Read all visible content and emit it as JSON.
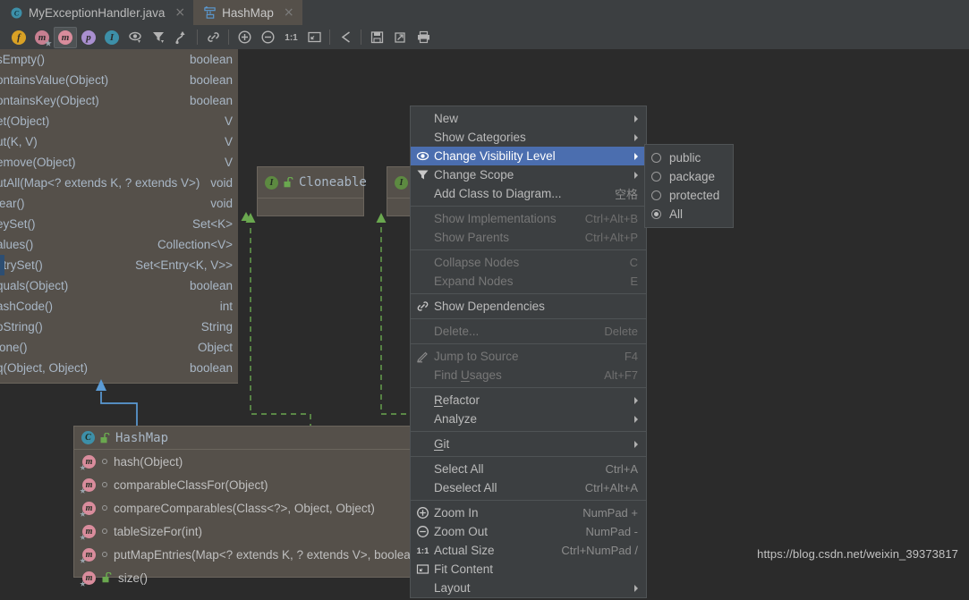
{
  "window": {
    "title": "HashMap",
    "watermark": "https://blog.csdn.net/weixin_39373817"
  },
  "tabs": [
    {
      "label": "MyExceptionHandler.java",
      "icon": "java-class-icon",
      "active": false,
      "close": "×"
    },
    {
      "label": "HashMap",
      "icon": "uml-diagram-icon",
      "active": true,
      "close": "×"
    }
  ],
  "toolbar": {
    "buttons": [
      {
        "name": "show-fields-button",
        "glyph": "f",
        "color": "#d9a125",
        "selected": false
      },
      {
        "name": "show-constructors-button",
        "glyph": "m",
        "color": "#c77f91",
        "selected": false
      },
      {
        "name": "show-methods-button",
        "glyph": "m",
        "color": "#d98c9c",
        "selected": true
      },
      {
        "name": "show-properties-button",
        "glyph": "p",
        "color": "#a98fd0",
        "selected": false
      },
      {
        "name": "show-inner-classes-button",
        "glyph": "I",
        "color": "#3d8fa8",
        "selected": false
      },
      {
        "name": "change-visibility-level-button",
        "glyph": "eye",
        "color": "#b3b3b3",
        "selected": false
      },
      {
        "name": "change-scope-button",
        "glyph": "funnel",
        "color": "#b3b3b3",
        "selected": false
      },
      {
        "name": "show-dependencies-button",
        "glyph": "curve",
        "color": "#b3b3b3",
        "selected": false
      },
      {
        "name": "toolbar-separator-1",
        "glyph": "sep",
        "color": "",
        "selected": false
      },
      {
        "name": "show-links-button",
        "glyph": "link",
        "color": "#b3b3b3",
        "selected": false
      },
      {
        "name": "toolbar-separator-2",
        "glyph": "sep",
        "color": "",
        "selected": false
      },
      {
        "name": "zoom-in-button",
        "glyph": "plus-circle",
        "color": "#b3b3b3",
        "selected": false
      },
      {
        "name": "zoom-out-button",
        "glyph": "minus-circle",
        "color": "#b3b3b3",
        "selected": false
      },
      {
        "name": "actual-size-button",
        "glyph": "1:1",
        "color": "#b3b3b3",
        "selected": false
      },
      {
        "name": "fit-content-button",
        "glyph": "fit",
        "color": "#b3b3b3",
        "selected": false
      },
      {
        "name": "toolbar-separator-3",
        "glyph": "sep",
        "color": "",
        "selected": false
      },
      {
        "name": "layout-button",
        "glyph": "layout",
        "color": "#b3b3b3",
        "selected": false
      },
      {
        "name": "toolbar-separator-4",
        "glyph": "sep",
        "color": "",
        "selected": false
      },
      {
        "name": "save-button",
        "glyph": "floppy",
        "color": "#b3b3b3",
        "selected": false
      },
      {
        "name": "export-button",
        "glyph": "export",
        "color": "#b3b3b3",
        "selected": false
      },
      {
        "name": "print-button",
        "glyph": "printer",
        "color": "#b3b3b3",
        "selected": false
      }
    ]
  },
  "left_panel": {
    "selected_index": 10,
    "rows": [
      {
        "name": "sEmpty()",
        "type": "boolean"
      },
      {
        "name": "ontainsValue(Object)",
        "type": "boolean"
      },
      {
        "name": "ontainsKey(Object)",
        "type": "boolean"
      },
      {
        "name": "et(Object)",
        "type": "V"
      },
      {
        "name": "ut(K, V)",
        "type": "V"
      },
      {
        "name": "emove(Object)",
        "type": "V"
      },
      {
        "name": "utAll(Map<? extends K, ? extends V>)",
        "type": "void"
      },
      {
        "name": "lear()",
        "type": "void"
      },
      {
        "name": "eySet()",
        "type": "Set<K>"
      },
      {
        "name": "alues()",
        "type": "Collection<V>"
      },
      {
        "name": "ntrySet()",
        "type": "Set<Entry<K, V>>"
      },
      {
        "name": "quals(Object)",
        "type": "boolean"
      },
      {
        "name": "ashCode()",
        "type": "int"
      },
      {
        "name": "oString()",
        "type": "String"
      },
      {
        "name": "lone()",
        "type": "Object"
      },
      {
        "name": "q(Object, Object)",
        "type": "boolean"
      }
    ]
  },
  "diagram": {
    "nodes": [
      {
        "name": "cloneable-node",
        "title": "Cloneable",
        "kind": "I",
        "kind_color": "#5d8a41"
      },
      {
        "name": "second-interface-node",
        "title": "",
        "kind": "I",
        "kind_color": "#5d8a41"
      }
    ],
    "hashmap_node": {
      "title": "HashMap",
      "kind": "C",
      "kind_color": "#3d8fa8",
      "members": [
        {
          "label": "hash(Object)",
          "vis": "private"
        },
        {
          "label": "comparableClassFor(Object)",
          "vis": "private"
        },
        {
          "label": "compareComparables(Class<?>, Object, Object)",
          "vis": "private"
        },
        {
          "label": "tableSizeFor(int)",
          "vis": "private"
        },
        {
          "label": "putMapEntries(Map<? extends K, ? extends V>, boolean)",
          "vis": "private"
        },
        {
          "label": "size()",
          "vis": "public"
        }
      ]
    },
    "edges": {
      "inherits_color": "#5b9bd5",
      "implements_color": "#6aa84f"
    }
  },
  "context_menu": {
    "items": [
      {
        "label": "New",
        "key": "",
        "icon": "",
        "submenu": true,
        "disabled": false,
        "highlight": false,
        "mnemonic": ""
      },
      {
        "label": "Show Categories",
        "key": "",
        "icon": "",
        "submenu": true,
        "disabled": false,
        "highlight": false,
        "mnemonic": ""
      },
      {
        "label": "Change Visibility Level",
        "key": "",
        "icon": "eye-icon",
        "submenu": true,
        "disabled": false,
        "highlight": true,
        "mnemonic": ""
      },
      {
        "label": "Change Scope",
        "key": "",
        "icon": "funnel-icon",
        "submenu": true,
        "disabled": false,
        "highlight": false,
        "mnemonic": ""
      },
      {
        "label": "Add Class to Diagram...",
        "key": "空格",
        "icon": "",
        "submenu": false,
        "disabled": false,
        "highlight": false,
        "mnemonic": ""
      },
      {
        "separator": true
      },
      {
        "label": "Show Implementations",
        "key": "Ctrl+Alt+B",
        "icon": "",
        "submenu": false,
        "disabled": true,
        "highlight": false,
        "mnemonic": ""
      },
      {
        "label": "Show Parents",
        "key": "Ctrl+Alt+P",
        "icon": "",
        "submenu": false,
        "disabled": true,
        "highlight": false,
        "mnemonic": ""
      },
      {
        "separator": true
      },
      {
        "label": "Collapse Nodes",
        "key": "C",
        "icon": "",
        "submenu": false,
        "disabled": true,
        "highlight": false,
        "mnemonic": ""
      },
      {
        "label": "Expand Nodes",
        "key": "E",
        "icon": "",
        "submenu": false,
        "disabled": true,
        "highlight": false,
        "mnemonic": ""
      },
      {
        "separator": true
      },
      {
        "label": "Show Dependencies",
        "key": "",
        "icon": "link-icon",
        "submenu": false,
        "disabled": false,
        "highlight": false,
        "mnemonic": ""
      },
      {
        "separator": true
      },
      {
        "label": "Delete...",
        "key": "Delete",
        "icon": "",
        "submenu": false,
        "disabled": true,
        "highlight": false,
        "mnemonic": ""
      },
      {
        "separator": true
      },
      {
        "label": "Jump to Source",
        "key": "F4",
        "icon": "pencil-icon",
        "submenu": false,
        "disabled": true,
        "highlight": false,
        "mnemonic": ""
      },
      {
        "label": "Find Usages",
        "key": "Alt+F7",
        "icon": "",
        "submenu": false,
        "disabled": true,
        "highlight": false,
        "mnemonic": "U"
      },
      {
        "separator": true
      },
      {
        "label": "Refactor",
        "key": "",
        "icon": "",
        "submenu": true,
        "disabled": false,
        "highlight": false,
        "mnemonic": "R"
      },
      {
        "label": "Analyze",
        "key": "",
        "icon": "",
        "submenu": true,
        "disabled": false,
        "highlight": false,
        "mnemonic": ""
      },
      {
        "separator": true
      },
      {
        "label": "Git",
        "key": "",
        "icon": "",
        "submenu": true,
        "disabled": false,
        "highlight": false,
        "mnemonic": "G"
      },
      {
        "separator": true
      },
      {
        "label": "Select All",
        "key": "Ctrl+A",
        "icon": "",
        "submenu": false,
        "disabled": false,
        "highlight": false,
        "mnemonic": ""
      },
      {
        "label": "Deselect All",
        "key": "Ctrl+Alt+A",
        "icon": "",
        "submenu": false,
        "disabled": false,
        "highlight": false,
        "mnemonic": ""
      },
      {
        "separator": true
      },
      {
        "label": "Zoom In",
        "key": "NumPad +",
        "icon": "plus-circle-icon",
        "submenu": false,
        "disabled": false,
        "highlight": false,
        "mnemonic": ""
      },
      {
        "label": "Zoom Out",
        "key": "NumPad -",
        "icon": "minus-circle-icon",
        "submenu": false,
        "disabled": false,
        "highlight": false,
        "mnemonic": ""
      },
      {
        "label": "Actual Size",
        "key": "Ctrl+NumPad /",
        "icon": "one-to-one-icon",
        "submenu": false,
        "disabled": false,
        "highlight": false,
        "mnemonic": ""
      },
      {
        "label": "Fit Content",
        "key": "",
        "icon": "fit-content-icon",
        "submenu": false,
        "disabled": false,
        "highlight": false,
        "mnemonic": ""
      },
      {
        "label": "Layout",
        "key": "",
        "icon": "",
        "submenu": true,
        "disabled": false,
        "highlight": false,
        "mnemonic": ""
      }
    ]
  },
  "visibility_submenu": {
    "options": [
      {
        "label": "public",
        "selected": false
      },
      {
        "label": "package",
        "selected": false
      },
      {
        "label": "protected",
        "selected": false
      },
      {
        "label": "All",
        "selected": true
      }
    ]
  }
}
